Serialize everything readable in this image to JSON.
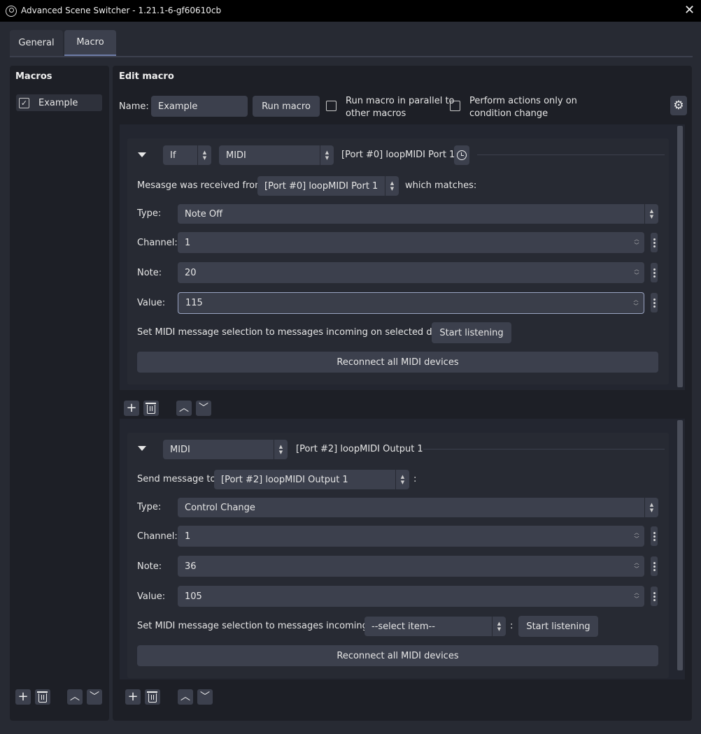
{
  "window": {
    "title": "Advanced Scene Switcher - 1.21.1-6-gf60610cb",
    "close_glyph": "✕"
  },
  "tabs": [
    {
      "label": "General"
    },
    {
      "label": "Macro"
    }
  ],
  "macros_panel": {
    "heading": "Macros",
    "items": [
      {
        "name": "Example",
        "checked": true
      }
    ]
  },
  "edit_macro": {
    "heading": "Edit macro",
    "name_label": "Name:",
    "name_value": "Example",
    "run_button": "Run macro",
    "parallel_label_1": "Run macro in parallel to",
    "parallel_label_2": "other macros",
    "condition_change_label_1": "Perform actions only on",
    "condition_change_label_2": "condition change"
  },
  "condition": {
    "logic": "If",
    "type": "MIDI",
    "summary": "[Port #0] loopMIDI Port 1",
    "received_label": "Mesasge was received from",
    "port": "[Port #0] loopMIDI Port 1",
    "matches_label": "which matches:",
    "type_label": "Type:",
    "type_value": "Note Off",
    "channel_label": "Channel:",
    "channel_value": "1",
    "note_label": "Note:",
    "note_value": "20",
    "value_label": "Value:",
    "value_value": "115",
    "listen_label": "Set MIDI message selection to messages incoming on selected device:",
    "listen_button": "Start listening",
    "reconnect_button": "Reconnect all MIDI devices"
  },
  "action": {
    "type": "MIDI",
    "summary": "[Port #2] loopMIDI Output 1",
    "send_label": "Send message to",
    "port": "[Port #2] loopMIDI Output 1",
    "colon": ":",
    "type_label": "Type:",
    "type_value": "Control Change",
    "channel_label": "Channel:",
    "channel_value": "1",
    "note_label": "Note:",
    "note_value": "36",
    "value_label": "Value:",
    "value_value": "105",
    "listen_label": "Set MIDI message selection to messages incoming on",
    "listen_select": "--select item--",
    "listen_colon": ":",
    "listen_button": "Start listening",
    "reconnect_button": "Reconnect all MIDI devices"
  },
  "icons": {
    "add": "+",
    "up": "︿",
    "down": "﹀",
    "gear": "⚙",
    "check": "✓",
    "spin_up": "▲",
    "spin_down": "▼"
  },
  "colors": {
    "background": "#1d1f26",
    "surface": "#272a33",
    "control": "#3c404d",
    "accent": "#6f7da8"
  }
}
